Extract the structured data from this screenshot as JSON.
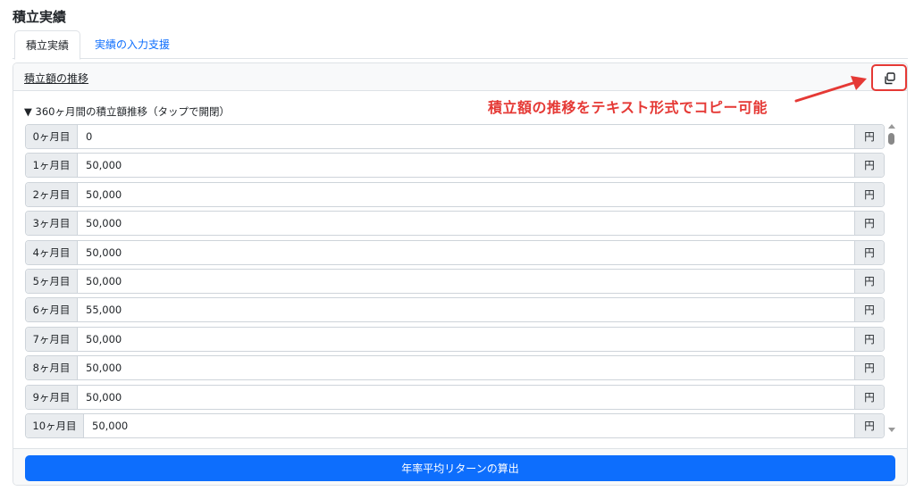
{
  "page": {
    "title": "積立実績"
  },
  "tabs": [
    {
      "label": "積立実績",
      "active": true
    },
    {
      "label": "実績の入力支援",
      "active": false
    }
  ],
  "card": {
    "title": "積立額の推移",
    "copy_icon": "copy-icon",
    "annotation": "積立額の推移をテキスト形式でコピー可能",
    "summary": "▼ 360ヶ月間の積立額推移（タップで開閉）",
    "rows": [
      {
        "month": "0ヶ月目",
        "value": "0",
        "unit": "円"
      },
      {
        "month": "1ヶ月目",
        "value": "50,000",
        "unit": "円"
      },
      {
        "month": "2ヶ月目",
        "value": "50,000",
        "unit": "円"
      },
      {
        "month": "3ヶ月目",
        "value": "50,000",
        "unit": "円"
      },
      {
        "month": "4ヶ月目",
        "value": "50,000",
        "unit": "円"
      },
      {
        "month": "5ヶ月目",
        "value": "50,000",
        "unit": "円"
      },
      {
        "month": "6ヶ月目",
        "value": "55,000",
        "unit": "円"
      },
      {
        "month": "7ヶ月目",
        "value": "50,000",
        "unit": "円"
      },
      {
        "month": "8ヶ月目",
        "value": "50,000",
        "unit": "円"
      },
      {
        "month": "9ヶ月目",
        "value": "50,000",
        "unit": "円"
      },
      {
        "month": "10ヶ月目",
        "value": "50,000",
        "unit": "円"
      }
    ],
    "calc_button": "年率平均リターンの算出"
  },
  "colors": {
    "accent": "#0d6efd",
    "annotation": "#e53935"
  }
}
